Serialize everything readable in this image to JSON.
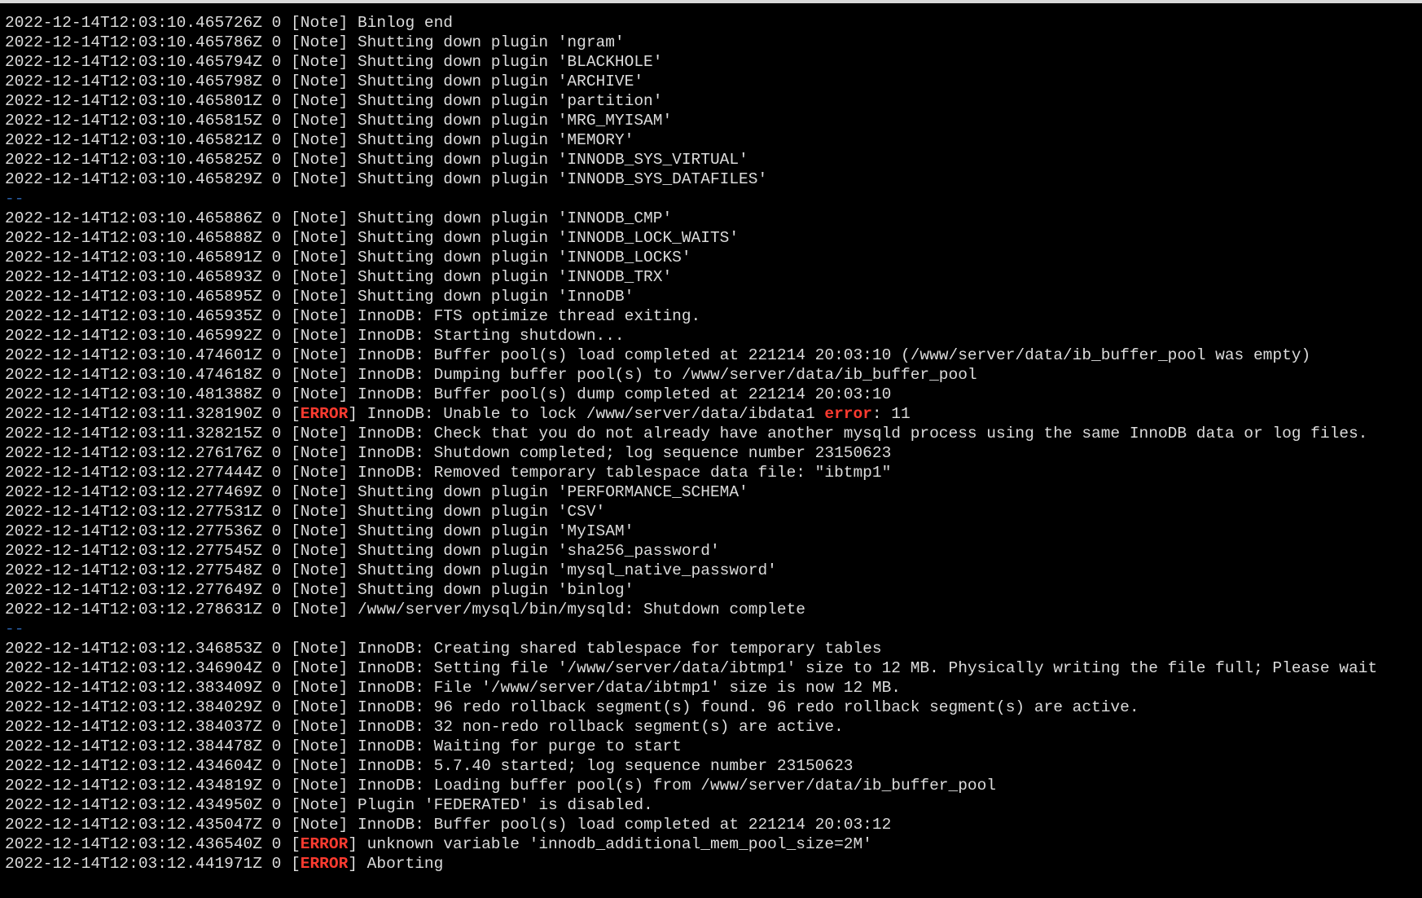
{
  "theme": {
    "background": "#000000",
    "foreground": "#dcdcdc",
    "error_color": "#ff3b30",
    "separator_color": "#2a5fa8"
  },
  "lines": [
    {
      "type": "log",
      "ts": "2022-12-14T12:03:10.465726Z 0 ",
      "lvl": "Note",
      "msg": " Binlog end"
    },
    {
      "type": "log",
      "ts": "2022-12-14T12:03:10.465786Z 0 ",
      "lvl": "Note",
      "msg": " Shutting down plugin 'ngram'"
    },
    {
      "type": "log",
      "ts": "2022-12-14T12:03:10.465794Z 0 ",
      "lvl": "Note",
      "msg": " Shutting down plugin 'BLACKHOLE'"
    },
    {
      "type": "log",
      "ts": "2022-12-14T12:03:10.465798Z 0 ",
      "lvl": "Note",
      "msg": " Shutting down plugin 'ARCHIVE'"
    },
    {
      "type": "log",
      "ts": "2022-12-14T12:03:10.465801Z 0 ",
      "lvl": "Note",
      "msg": " Shutting down plugin 'partition'"
    },
    {
      "type": "log",
      "ts": "2022-12-14T12:03:10.465815Z 0 ",
      "lvl": "Note",
      "msg": " Shutting down plugin 'MRG_MYISAM'"
    },
    {
      "type": "log",
      "ts": "2022-12-14T12:03:10.465821Z 0 ",
      "lvl": "Note",
      "msg": " Shutting down plugin 'MEMORY'"
    },
    {
      "type": "log",
      "ts": "2022-12-14T12:03:10.465825Z 0 ",
      "lvl": "Note",
      "msg": " Shutting down plugin 'INNODB_SYS_VIRTUAL'"
    },
    {
      "type": "log",
      "ts": "2022-12-14T12:03:10.465829Z 0 ",
      "lvl": "Note",
      "msg": " Shutting down plugin 'INNODB_SYS_DATAFILES'"
    },
    {
      "type": "sep",
      "text": "--"
    },
    {
      "type": "log",
      "ts": "2022-12-14T12:03:10.465886Z 0 ",
      "lvl": "Note",
      "msg": " Shutting down plugin 'INNODB_CMP'"
    },
    {
      "type": "log",
      "ts": "2022-12-14T12:03:10.465888Z 0 ",
      "lvl": "Note",
      "msg": " Shutting down plugin 'INNODB_LOCK_WAITS'"
    },
    {
      "type": "log",
      "ts": "2022-12-14T12:03:10.465891Z 0 ",
      "lvl": "Note",
      "msg": " Shutting down plugin 'INNODB_LOCKS'"
    },
    {
      "type": "log",
      "ts": "2022-12-14T12:03:10.465893Z 0 ",
      "lvl": "Note",
      "msg": " Shutting down plugin 'INNODB_TRX'"
    },
    {
      "type": "log",
      "ts": "2022-12-14T12:03:10.465895Z 0 ",
      "lvl": "Note",
      "msg": " Shutting down plugin 'InnoDB'"
    },
    {
      "type": "log",
      "ts": "2022-12-14T12:03:10.465935Z 0 ",
      "lvl": "Note",
      "msg": " InnoDB: FTS optimize thread exiting."
    },
    {
      "type": "log",
      "ts": "2022-12-14T12:03:10.465992Z 0 ",
      "lvl": "Note",
      "msg": " InnoDB: Starting shutdown..."
    },
    {
      "type": "log",
      "ts": "2022-12-14T12:03:10.474601Z 0 ",
      "lvl": "Note",
      "msg": " InnoDB: Buffer pool(s) load completed at 221214 20:03:10 (/www/server/data/ib_buffer_pool was empty)"
    },
    {
      "type": "log",
      "ts": "2022-12-14T12:03:10.474618Z 0 ",
      "lvl": "Note",
      "msg": " InnoDB: Dumping buffer pool(s) to /www/server/data/ib_buffer_pool"
    },
    {
      "type": "log",
      "ts": "2022-12-14T12:03:10.481388Z 0 ",
      "lvl": "Note",
      "msg": " InnoDB: Buffer pool(s) dump completed at 221214 20:03:10"
    },
    {
      "type": "log",
      "ts": "2022-12-14T12:03:11.328190Z 0 ",
      "lvl": "ERROR",
      "msg": " InnoDB: Unable to lock /www/server/data/ibdata1 ",
      "err_word": "error",
      "tail": ": 11"
    },
    {
      "type": "log",
      "ts": "2022-12-14T12:03:11.328215Z 0 ",
      "lvl": "Note",
      "msg": " InnoDB: Check that you do not already have another mysqld process using the same InnoDB data or log files."
    },
    {
      "type": "log",
      "ts": "2022-12-14T12:03:12.276176Z 0 ",
      "lvl": "Note",
      "msg": " InnoDB: Shutdown completed; log sequence number 23150623"
    },
    {
      "type": "log",
      "ts": "2022-12-14T12:03:12.277444Z 0 ",
      "lvl": "Note",
      "msg": " InnoDB: Removed temporary tablespace data file: \"ibtmp1\""
    },
    {
      "type": "log",
      "ts": "2022-12-14T12:03:12.277469Z 0 ",
      "lvl": "Note",
      "msg": " Shutting down plugin 'PERFORMANCE_SCHEMA'"
    },
    {
      "type": "log",
      "ts": "2022-12-14T12:03:12.277531Z 0 ",
      "lvl": "Note",
      "msg": " Shutting down plugin 'CSV'"
    },
    {
      "type": "log",
      "ts": "2022-12-14T12:03:12.277536Z 0 ",
      "lvl": "Note",
      "msg": " Shutting down plugin 'MyISAM'"
    },
    {
      "type": "log",
      "ts": "2022-12-14T12:03:12.277545Z 0 ",
      "lvl": "Note",
      "msg": " Shutting down plugin 'sha256_password'"
    },
    {
      "type": "log",
      "ts": "2022-12-14T12:03:12.277548Z 0 ",
      "lvl": "Note",
      "msg": " Shutting down plugin 'mysql_native_password'"
    },
    {
      "type": "log",
      "ts": "2022-12-14T12:03:12.277649Z 0 ",
      "lvl": "Note",
      "msg": " Shutting down plugin 'binlog'"
    },
    {
      "type": "log",
      "ts": "2022-12-14T12:03:12.278631Z 0 ",
      "lvl": "Note",
      "msg": " /www/server/mysql/bin/mysqld: Shutdown complete"
    },
    {
      "type": "sep",
      "text": "--"
    },
    {
      "type": "log",
      "ts": "2022-12-14T12:03:12.346853Z 0 ",
      "lvl": "Note",
      "msg": " InnoDB: Creating shared tablespace for temporary tables"
    },
    {
      "type": "log",
      "ts": "2022-12-14T12:03:12.346904Z 0 ",
      "lvl": "Note",
      "msg": " InnoDB: Setting file '/www/server/data/ibtmp1' size to 12 MB. Physically writing the file full; Please wait"
    },
    {
      "type": "log",
      "ts": "2022-12-14T12:03:12.383409Z 0 ",
      "lvl": "Note",
      "msg": " InnoDB: File '/www/server/data/ibtmp1' size is now 12 MB."
    },
    {
      "type": "log",
      "ts": "2022-12-14T12:03:12.384029Z 0 ",
      "lvl": "Note",
      "msg": " InnoDB: 96 redo rollback segment(s) found. 96 redo rollback segment(s) are active."
    },
    {
      "type": "log",
      "ts": "2022-12-14T12:03:12.384037Z 0 ",
      "lvl": "Note",
      "msg": " InnoDB: 32 non-redo rollback segment(s) are active."
    },
    {
      "type": "log",
      "ts": "2022-12-14T12:03:12.384478Z 0 ",
      "lvl": "Note",
      "msg": " InnoDB: Waiting for purge to start"
    },
    {
      "type": "log",
      "ts": "2022-12-14T12:03:12.434604Z 0 ",
      "lvl": "Note",
      "msg": " InnoDB: 5.7.40 started; log sequence number 23150623"
    },
    {
      "type": "log",
      "ts": "2022-12-14T12:03:12.434819Z 0 ",
      "lvl": "Note",
      "msg": " InnoDB: Loading buffer pool(s) from /www/server/data/ib_buffer_pool"
    },
    {
      "type": "log",
      "ts": "2022-12-14T12:03:12.434950Z 0 ",
      "lvl": "Note",
      "msg": " Plugin 'FEDERATED' is disabled."
    },
    {
      "type": "log",
      "ts": "2022-12-14T12:03:12.435047Z 0 ",
      "lvl": "Note",
      "msg": " InnoDB: Buffer pool(s) load completed at 221214 20:03:12"
    },
    {
      "type": "log",
      "ts": "2022-12-14T12:03:12.436540Z 0 ",
      "lvl": "ERROR",
      "msg": " unknown variable 'innodb_additional_mem_pool_size=2M'"
    },
    {
      "type": "log",
      "ts": "2022-12-14T12:03:12.441971Z 0 ",
      "lvl": "ERROR",
      "msg": " Aborting"
    }
  ]
}
